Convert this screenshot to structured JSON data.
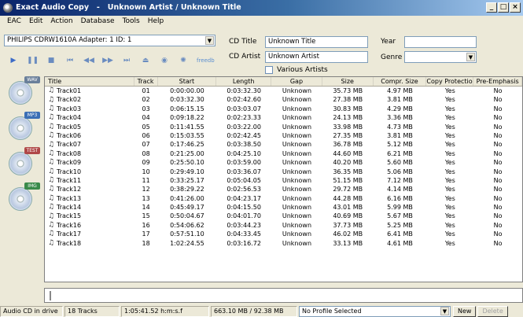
{
  "window": {
    "title": "Exact Audio Copy   -   Unknown Artist / Unknown Title",
    "min_label": "_",
    "max_label": "□",
    "close_label": "×"
  },
  "menu": [
    "EAC",
    "Edit",
    "Action",
    "Database",
    "Tools",
    "Help"
  ],
  "drive": {
    "selected": "PHILIPS CDRW1610A  Adapter: 1  ID: 1"
  },
  "toolbar": {
    "icons": [
      "play-icon",
      "pause-icon",
      "stop-icon",
      "previous-track-icon",
      "rewind-icon",
      "fast-forward-icon",
      "next-track-icon",
      "eject-icon",
      "cd-text-icon",
      "freedb-icon"
    ],
    "freedb_label": "freedb"
  },
  "cd_info": {
    "title_label": "CD Title",
    "title_value": "Unknown Title",
    "artist_label": "CD Artist",
    "artist_value": "Unknown Artist",
    "year_label": "Year",
    "year_value": "",
    "genre_label": "Genre",
    "genre_value": "",
    "various_label": "Various Artists",
    "various_checked": false
  },
  "side_buttons": [
    {
      "name": "copy-wav",
      "tag": "WAV",
      "color": "#6a7f9a"
    },
    {
      "name": "copy-mp3",
      "tag": "MP3",
      "color": "#3b6fb5"
    },
    {
      "name": "test-copy",
      "tag": "TEST",
      "color": "#b04848"
    },
    {
      "name": "copy-image",
      "tag": "IMG",
      "color": "#3a8a4a"
    }
  ],
  "table": {
    "columns": [
      "Title",
      "Track",
      "Start",
      "Length",
      "Gap",
      "Size",
      "Compr. Size",
      "Copy Protection",
      "Pre-Emphasis"
    ],
    "rows": [
      [
        "Track01",
        "01",
        "0:00:00.00",
        "0:03:32.30",
        "Unknown",
        "35.73 MB",
        "4.97 MB",
        "Yes",
        "No"
      ],
      [
        "Track02",
        "02",
        "0:03:32.30",
        "0:02:42.60",
        "Unknown",
        "27.38 MB",
        "3.81 MB",
        "Yes",
        "No"
      ],
      [
        "Track03",
        "03",
        "0:06:15.15",
        "0:03:03.07",
        "Unknown",
        "30.83 MB",
        "4.29 MB",
        "Yes",
        "No"
      ],
      [
        "Track04",
        "04",
        "0:09:18.22",
        "0:02:23.33",
        "Unknown",
        "24.13 MB",
        "3.36 MB",
        "Yes",
        "No"
      ],
      [
        "Track05",
        "05",
        "0:11:41.55",
        "0:03:22.00",
        "Unknown",
        "33.98 MB",
        "4.73 MB",
        "Yes",
        "No"
      ],
      [
        "Track06",
        "06",
        "0:15:03.55",
        "0:02:42.45",
        "Unknown",
        "27.35 MB",
        "3.81 MB",
        "Yes",
        "No"
      ],
      [
        "Track07",
        "07",
        "0:17:46.25",
        "0:03:38.50",
        "Unknown",
        "36.78 MB",
        "5.12 MB",
        "Yes",
        "No"
      ],
      [
        "Track08",
        "08",
        "0:21:25.00",
        "0:04:25.10",
        "Unknown",
        "44.60 MB",
        "6.21 MB",
        "Yes",
        "No"
      ],
      [
        "Track09",
        "09",
        "0:25:50.10",
        "0:03:59.00",
        "Unknown",
        "40.20 MB",
        "5.60 MB",
        "Yes",
        "No"
      ],
      [
        "Track10",
        "10",
        "0:29:49.10",
        "0:03:36.07",
        "Unknown",
        "36.35 MB",
        "5.06 MB",
        "Yes",
        "No"
      ],
      [
        "Track11",
        "11",
        "0:33:25.17",
        "0:05:04.05",
        "Unknown",
        "51.15 MB",
        "7.12 MB",
        "Yes",
        "No"
      ],
      [
        "Track12",
        "12",
        "0:38:29.22",
        "0:02:56.53",
        "Unknown",
        "29.72 MB",
        "4.14 MB",
        "Yes",
        "No"
      ],
      [
        "Track13",
        "13",
        "0:41:26.00",
        "0:04:23.17",
        "Unknown",
        "44.28 MB",
        "6.16 MB",
        "Yes",
        "No"
      ],
      [
        "Track14",
        "14",
        "0:45:49.17",
        "0:04:15.50",
        "Unknown",
        "43.01 MB",
        "5.99 MB",
        "Yes",
        "No"
      ],
      [
        "Track15",
        "15",
        "0:50:04.67",
        "0:04:01.70",
        "Unknown",
        "40.69 MB",
        "5.67 MB",
        "Yes",
        "No"
      ],
      [
        "Track16",
        "16",
        "0:54:06.62",
        "0:03:44.23",
        "Unknown",
        "37.73 MB",
        "5.25 MB",
        "Yes",
        "No"
      ],
      [
        "Track17",
        "17",
        "0:57:51.10",
        "0:04:33.45",
        "Unknown",
        "46.02 MB",
        "6.41 MB",
        "Yes",
        "No"
      ],
      [
        "Track18",
        "18",
        "1:02:24.55",
        "0:03:16.72",
        "Unknown",
        "33.13 MB",
        "4.61 MB",
        "Yes",
        "No"
      ]
    ]
  },
  "status": {
    "drive_state": "Audio CD in drive",
    "tracks": "18 Tracks",
    "total_time": "1:05:41.52 h:m:s.f",
    "sizes": "663.10 MB / 92.38 MB",
    "profile": "No Profile Selected",
    "new_label": "New",
    "delete_label": "Delete"
  }
}
